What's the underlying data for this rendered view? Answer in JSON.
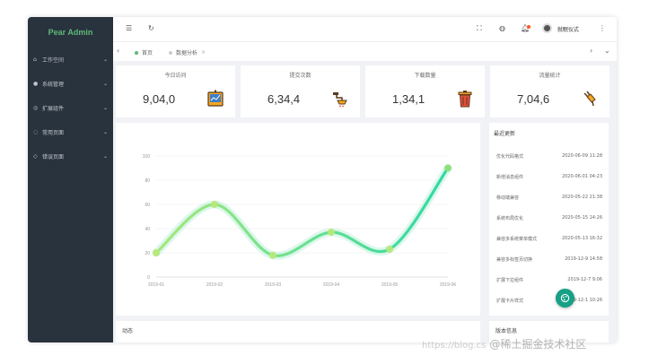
{
  "sidebar": {
    "logo": "Pear Admin",
    "items": [
      {
        "label": "工作空间",
        "icon": "home-icon"
      },
      {
        "label": "系统管理",
        "icon": "gear-icon"
      },
      {
        "label": "扩展组件",
        "icon": "component-icon"
      },
      {
        "label": "常用页面",
        "icon": "page-icon"
      },
      {
        "label": "错误页面",
        "icon": "error-icon"
      }
    ]
  },
  "header": {
    "username": "就眠仪式"
  },
  "tabs": [
    {
      "label": "首页",
      "dot_color": "#5fb878"
    },
    {
      "label": "数据分析",
      "dot_color": "#cccccc"
    }
  ],
  "stats": [
    {
      "title": "今日访问",
      "value": "9,04,0",
      "icon": "chart-board-icon"
    },
    {
      "title": "提交次数",
      "value": "6,34,4",
      "icon": "tap-icon"
    },
    {
      "title": "下载数量",
      "value": "1,34,1",
      "icon": "trash-icon"
    },
    {
      "title": "流量统计",
      "value": "7,04,6",
      "icon": "plug-icon"
    }
  ],
  "recent": {
    "title": "最近更新",
    "rows": [
      {
        "text": "优化代码格式",
        "date": "2020-06-09 11:28"
      },
      {
        "text": "新增消息组件",
        "date": "2020-06-01 04:23"
      },
      {
        "text": "移动端兼容",
        "date": "2020-05-22 21:38"
      },
      {
        "text": "系统布局优化",
        "date": "2020-05-15 14:26"
      },
      {
        "text": "兼容多系统菜单模式",
        "date": "2020-05-13 16:32"
      },
      {
        "text": "兼容多标签页切换",
        "date": "2019-12-9 14:58"
      },
      {
        "text": "扩展下拉组件",
        "date": "2019-12-7 9:06"
      },
      {
        "text": "扩展卡片样式",
        "date": "2019-12-1 10:26"
      }
    ]
  },
  "bottom": {
    "left_title": "动态",
    "right_title": "版本信息"
  },
  "watermark": {
    "url": "https://blog.cs",
    "text": "@稀土掘金技术社区"
  },
  "colors": {
    "accent": "#5fb878",
    "sidebar_bg": "#28333e",
    "line_start": "#a6e87b",
    "line_end": "#2fd8a6",
    "fab": "#16a085"
  },
  "chart_data": {
    "type": "line",
    "categories": [
      "2019-01",
      "2019-02",
      "2019-03",
      "2019-04",
      "2019-05",
      "2019-06"
    ],
    "series": [
      {
        "values": [
          20,
          60,
          18,
          37,
          23,
          90
        ]
      }
    ],
    "yticks": [
      0,
      20,
      40,
      60,
      80,
      100
    ],
    "ylim": [
      0,
      100
    ],
    "smooth": true,
    "grid": true
  }
}
